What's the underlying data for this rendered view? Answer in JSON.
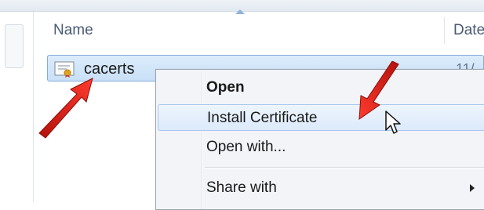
{
  "header": {
    "columns": [
      {
        "label": "Name"
      },
      {
        "label": "Date"
      }
    ]
  },
  "file": {
    "name": "cacerts",
    "date": "11/",
    "icon": "certificate-file-icon"
  },
  "context_menu": {
    "items": [
      {
        "label": "Open",
        "bold": true
      },
      {
        "label": "Install Certificate",
        "highlighted": true
      },
      {
        "label": "Open with..."
      },
      {
        "label": "Share with",
        "has_submenu": true
      }
    ]
  },
  "annotations": {
    "arrow_color": "#e0231b"
  }
}
